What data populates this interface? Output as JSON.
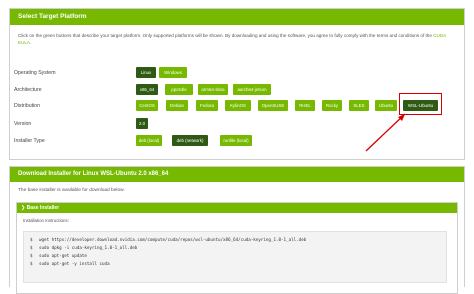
{
  "select_panel": {
    "title": "Select Target Platform",
    "intro_part1": "Click on the green buttons that describe your target platform. Only supported platforms will be shown. By downloading and using the software, you agree to fully comply with the terms and conditions of the ",
    "eula_link": "CUDA EULA",
    "intro_part2": "."
  },
  "rows": {
    "os": {
      "label": "Operating System",
      "options": [
        "Linux",
        "Windows"
      ]
    },
    "arch": {
      "label": "Architecture",
      "options": [
        "x86_64",
        "ppc64le",
        "arm64-sbsa",
        "aarch64-jetson"
      ]
    },
    "dist": {
      "label": "Distribution",
      "options": [
        "CentOS",
        "Debian",
        "Fedora",
        "KylinOS",
        "OpenSUSE",
        "RHEL",
        "Rocky",
        "SLES",
        "Ubuntu",
        "WSL-Ubuntu"
      ]
    },
    "version": {
      "label": "Version",
      "options": [
        "2.0"
      ]
    },
    "installer": {
      "label": "Installer Type",
      "options": [
        "deb (local)",
        "deb (network)",
        "runfile (local)"
      ]
    }
  },
  "download_panel": {
    "title": "Download Installer for Linux WSL-Ubuntu 2.0 x86_64",
    "base_text": "The base installer is available for download below.",
    "section_title": "Base Installer",
    "instructions_label": "Installation Instructions:",
    "commands": [
      "wget https://developer.download.nvidia.com/compute/cuda/repos/wsl-ubuntu/x86_64/cuda-keyring_1.0-1_all.deb",
      "sudo dpkg -i cuda-keyring_1.0-1_all.deb",
      "sudo apt-get update",
      "sudo apt-get -y install cuda"
    ],
    "prompt": "$"
  },
  "colors": {
    "accent": "#76b900",
    "selected": "#2f5a14",
    "highlight": "#d60000"
  }
}
